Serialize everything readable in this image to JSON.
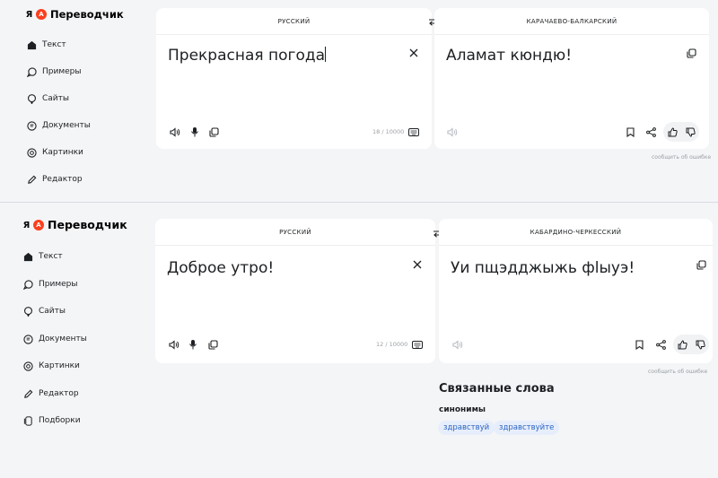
{
  "app": {
    "title": "Переводчик",
    "logo_letter": "Я",
    "badge_letter": "A"
  },
  "screens": [
    {
      "nav": [
        {
          "label": "Текст",
          "icon": "house-icon"
        },
        {
          "label": "Примеры",
          "icon": "chat-bubble-icon"
        },
        {
          "label": "Сайты",
          "icon": "speech-bubble-icon"
        },
        {
          "label": "Документы",
          "icon": "document-icon"
        },
        {
          "label": "Картинки",
          "icon": "image-icon"
        },
        {
          "label": "Редактор",
          "icon": "pencil-icon"
        }
      ],
      "source_lang": "РУССКИЙ",
      "target_lang": "КАРАЧАЕВО-БАЛКАРСКИЙ",
      "source_text": "Прекрасная погода",
      "translation": "Аламат кюндю!",
      "char_counter": "18 / 10000",
      "report_link": "сообщить об ошибке"
    },
    {
      "nav": [
        {
          "label": "Текст",
          "icon": "house-icon"
        },
        {
          "label": "Примеры",
          "icon": "chat-bubble-icon"
        },
        {
          "label": "Сайты",
          "icon": "speech-bubble-icon"
        },
        {
          "label": "Документы",
          "icon": "document-icon"
        },
        {
          "label": "Картинки",
          "icon": "image-icon"
        },
        {
          "label": "Редактор",
          "icon": "pencil-icon"
        },
        {
          "label": "Подборки",
          "icon": "collection-icon"
        }
      ],
      "source_lang": "РУССКИЙ",
      "target_lang": "КАБАРДИНО-ЧЕРКЕССКИЙ",
      "source_text": "Доброе утро!",
      "translation": "Уи пщэдджыжь фlыуэ!",
      "char_counter": "12 / 10000",
      "report_link": "сообщить об ошибке",
      "related": {
        "title": "Связанные слова",
        "subtitle": "синонимы",
        "chips": [
          "здравствуй",
          "здравствуйте"
        ]
      }
    }
  ],
  "colors": {
    "background": "#f4f5f7",
    "panel": "#ffffff",
    "logo_red": "#fc3f1d",
    "chip_bg": "#e7eefb",
    "chip_text": "#2a64c4",
    "muted": "#9aa0a6"
  }
}
